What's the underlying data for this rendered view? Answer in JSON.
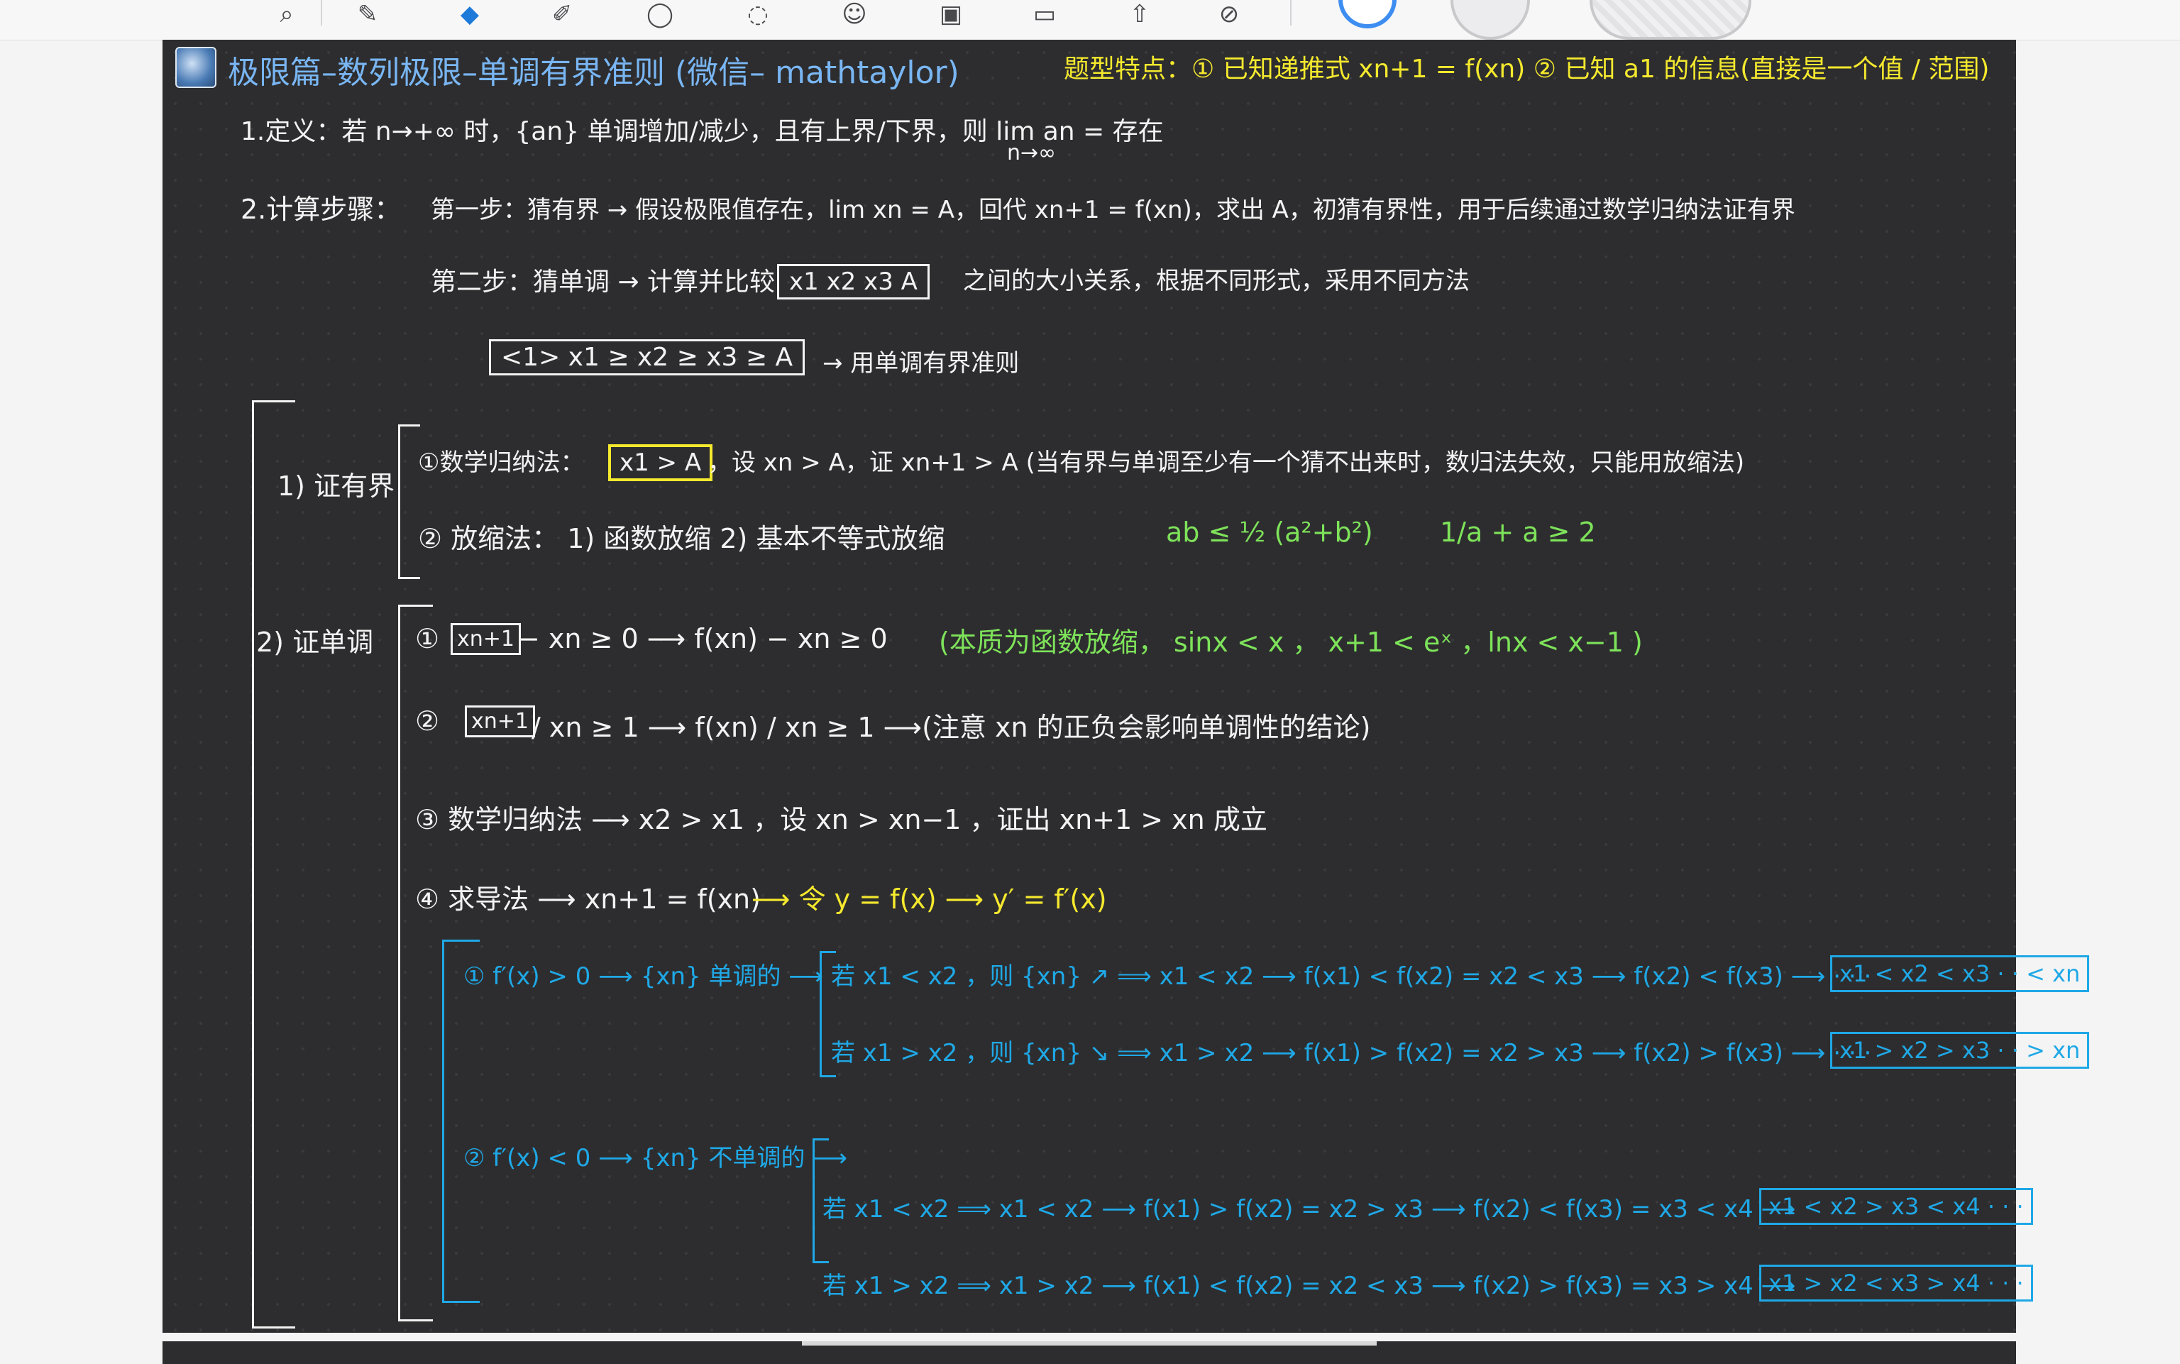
{
  "toolbar": {
    "tools": [
      {
        "name": "zoom-lasso-icon",
        "glyph": "⌕"
      },
      {
        "name": "pen-icon",
        "glyph": "✎"
      },
      {
        "name": "eraser-icon",
        "glyph": "◆"
      },
      {
        "name": "highlighter-icon",
        "glyph": "✐"
      },
      {
        "name": "shapes-icon",
        "glyph": "◯"
      },
      {
        "name": "lasso-icon",
        "glyph": "◌"
      },
      {
        "name": "sticker-icon",
        "glyph": "☺"
      },
      {
        "name": "image-icon",
        "glyph": "▣"
      },
      {
        "name": "text-box-icon",
        "glyph": "▭"
      },
      {
        "name": "upload-icon",
        "glyph": "⇧"
      },
      {
        "name": "link-icon",
        "glyph": "⊘"
      }
    ]
  },
  "header": {
    "title": "极限篇–数列极限–单调有界准则 (微信– mathtaylor)",
    "features": "题型特点：① 已知递推式 xn+1 = f(xn)   ② 已知 a1 的信息(直接是一个值 / 范围)"
  },
  "definition": "1.定义：若 n→+∞ 时，{an} 单调增加/减少，且有上界/下界，则 lim an = 存在",
  "lim_sub": "n→∞",
  "steps": {
    "label": "2.计算步骤：",
    "step1": "第一步：猜有界 → 假设极限值存在，lim xn = A，回代 xn+1 = f(xn)，求出 A，初猜有界性，用于后续通过数学归纳法证有界",
    "step2_prefix": "第二步：猜单调 → 计算并比较",
    "step2_box": "x1  x2  x3   A",
    "step2_suffix": "之间的大小关系，根据不同形式，采用不同方法",
    "chain_box": "<1>   x1 ≥ x2 ≥ x3 ≥ A",
    "chain_suffix": "→ 用单调有界准则"
  },
  "bounded": {
    "label": "1) 证有界",
    "m1_prefix": "①数学归纳法：",
    "m1_box": "x1 > A",
    "m1_suffix": "，设 xn > A，证 xn+1 > A (当有界与单调至少有一个猜不出来时，数归法失效，只能用放缩法)",
    "m2_prefix": "② 放缩法：     1) 函数放缩      2) 基本不等式放缩",
    "m2_f1": "ab ≤ ½ (a²+b²)",
    "m2_f2": "1/a + a ≥ 2"
  },
  "monotone": {
    "label": "2) 证单调",
    "r1_num": "①",
    "r1_box": "xn+1",
    "r1_text": "− xn ≥ 0     ⟶     f(xn) − xn ≥ 0",
    "r1_note": "(本质为函数放缩，  sinx < x  ，  x+1 < eˣ ，lnx < x−1  )",
    "r2_num": "②",
    "r2_box": "xn+1",
    "r2_text": "/ xn ≥ 1     ⟶     f(xn) / xn ≥ 1   ⟶(注意 xn 的正负会影响单调性的结论)",
    "r3": "③  数学归纳法   ⟶     x2 > x1 ，设 xn > xn−1 ，证出 xn+1 > xn 成立",
    "r4_prefix": "④  求导法 ⟶  xn+1 = f(xn)",
    "r4_yellow": "⟶ 令 y = f(x)  ⟶  y′ = f′(x)"
  },
  "derivative": {
    "case1_label": "①  f′(x) > 0 ⟶ {xn} 单调的 ⟶",
    "case1_a": "若 x1 < x2 ，则 {xn} ↗   ⟹   x1 < x2 ⟶ f(x1) < f(x2)  =  x2 < x3 ⟶  f(x2) < f(x3) ⟶ · · ·",
    "case1_a_box": "x1 < x2 < x3 · · < xn",
    "case1_b": "若 x1 > x2 ，则 {xn} ↘   ⟹   x1 > x2 ⟶ f(x1) > f(x2)  =  x2 > x3 ⟶  f(x2) > f(x3) ⟶ · · ·",
    "case1_b_box": "x1 > x2 > x3 · · > xn",
    "case2_label": "②  f′(x) < 0 ⟶ {xn} 不单调的 ⟶",
    "case2_a": "若 x1 < x2     ⟹    x1 < x2 ⟶ f(x1) > f(x2)  =  x2 > x3 ⟶  f(x2) < f(x3)  =  x3 < x4 ⟶",
    "case2_a_box": "x1 < x2 > x3 < x4 · · ·",
    "case2_b": "若 x1 > x2     ⟹    x1 > x2 ⟶ f(x1) < f(x2)  =  x2 < x3 ⟶  f(x2) > f(x3)  =  x3 > x4 ⟶",
    "case2_b_box": "x1 > x2 < x3 > x4 · · ·"
  }
}
